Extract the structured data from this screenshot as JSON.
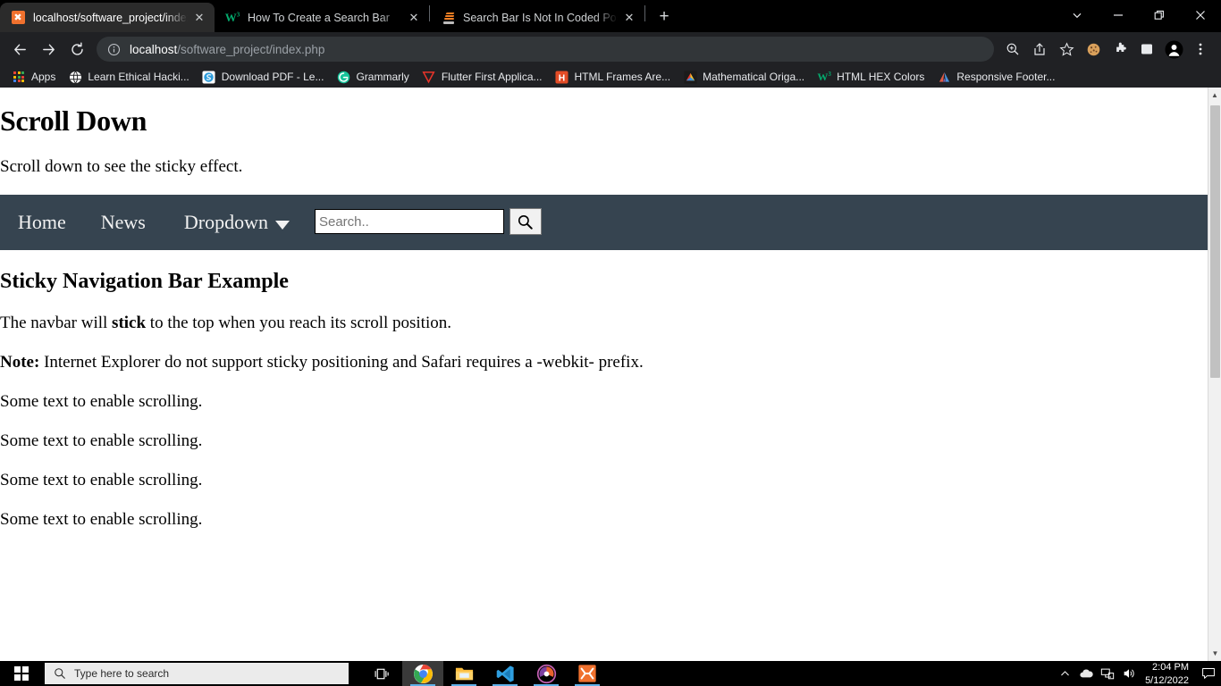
{
  "window": {
    "controls": {
      "tab_search": "tab-search",
      "minimize": "minimize",
      "restore": "restore",
      "close": "close"
    }
  },
  "tabs": [
    {
      "title": "localhost/software_project/index.php",
      "favicon": "xampp-icon",
      "active": true,
      "close": "✕"
    },
    {
      "title": "How To Create a Search Bar",
      "favicon": "w3schools-icon",
      "active": false,
      "close": "✕"
    },
    {
      "title": "Search Bar Is Not In Coded Positi",
      "favicon": "stackoverflow-icon",
      "active": false,
      "close": "✕"
    }
  ],
  "newtab_label": "+",
  "toolbar": {
    "back": "←",
    "forward": "→",
    "reload": "⟳",
    "url_host": "localhost",
    "url_path": "/software_project/index.php",
    "right_icons": [
      "zoom-icon",
      "share-icon",
      "bookmark-star-icon",
      "cookie-icon",
      "extensions-icon",
      "sidepanel-icon",
      "profile-avatar",
      "chrome-menu-icon"
    ]
  },
  "bookmarks": {
    "apps_label": "Apps",
    "items": [
      {
        "label": "Learn Ethical Hacki...",
        "icon": "globe-icon",
        "color": "#ffffff"
      },
      {
        "label": "Download PDF - Le...",
        "icon": "smallpdf-icon",
        "color": "#3aa0e0"
      },
      {
        "label": "Grammarly",
        "icon": "grammarly-icon",
        "color": "#15c39a"
      },
      {
        "label": "Flutter First Applica...",
        "icon": "red-triangle-icon",
        "color": "#e8342a"
      },
      {
        "label": "HTML Frames Are...",
        "icon": "html-icon",
        "color": "#e34c26"
      },
      {
        "label": "Mathematical Origa...",
        "icon": "origami-icon",
        "color": "#f26d21"
      },
      {
        "label": "HTML HEX Colors",
        "icon": "w3schools-icon",
        "color": "#04AA6D"
      },
      {
        "label": "Responsive Footer...",
        "icon": "codepen-icon",
        "color": "#4a90d9"
      }
    ]
  },
  "page": {
    "heading": "Scroll Down",
    "subtext": "Scroll down to see the sticky effect.",
    "navbar": {
      "background": "#364450",
      "links": [
        {
          "label": "Home",
          "name": "nav-home"
        },
        {
          "label": "News",
          "name": "nav-news"
        },
        {
          "label": "Dropdown",
          "name": "nav-dropdown",
          "caret": true
        }
      ],
      "search": {
        "placeholder": "Search..",
        "value": "",
        "button_icon": "search-icon"
      }
    },
    "section_title": "Sticky Navigation Bar Example",
    "paragraphs": [
      {
        "parts": [
          {
            "t": "The navbar will ",
            "b": false
          },
          {
            "t": "stick",
            "b": true
          },
          {
            "t": " to the top when you reach its scroll position.",
            "b": false
          }
        ]
      },
      {
        "parts": [
          {
            "t": "Note:",
            "b": true
          },
          {
            "t": " Internet Explorer do not support sticky positioning and Safari requires a -webkit- prefix.",
            "b": false
          }
        ]
      },
      {
        "parts": [
          {
            "t": "Some text to enable scrolling.",
            "b": false
          }
        ]
      },
      {
        "parts": [
          {
            "t": "Some text to enable scrolling.",
            "b": false
          }
        ]
      },
      {
        "parts": [
          {
            "t": "Some text to enable scrolling.",
            "b": false
          }
        ]
      },
      {
        "parts": [
          {
            "t": "Some text to enable scrolling.",
            "b": false
          }
        ]
      }
    ],
    "scrollbar": {
      "up_arrow": "▲",
      "down_arrow": "▼"
    }
  },
  "taskbar": {
    "start": "windows-start-icon",
    "search_placeholder": "Type here to search",
    "task_view": "task-view-icon",
    "apps": [
      {
        "name": "chrome-taskbar-icon",
        "running": true,
        "active": true
      },
      {
        "name": "file-explorer-taskbar-icon",
        "running": true,
        "active": false
      },
      {
        "name": "vscode-taskbar-icon",
        "running": true,
        "active": false
      },
      {
        "name": "media-player-taskbar-icon",
        "running": true,
        "active": false
      },
      {
        "name": "xampp-taskbar-icon",
        "running": true,
        "active": false
      }
    ],
    "tray": [
      "show-hidden-icons",
      "onedrive-icon",
      "network-icon",
      "volume-icon"
    ],
    "time": "2:04 PM",
    "date": "5/12/2022",
    "notification": "action-center-icon"
  }
}
